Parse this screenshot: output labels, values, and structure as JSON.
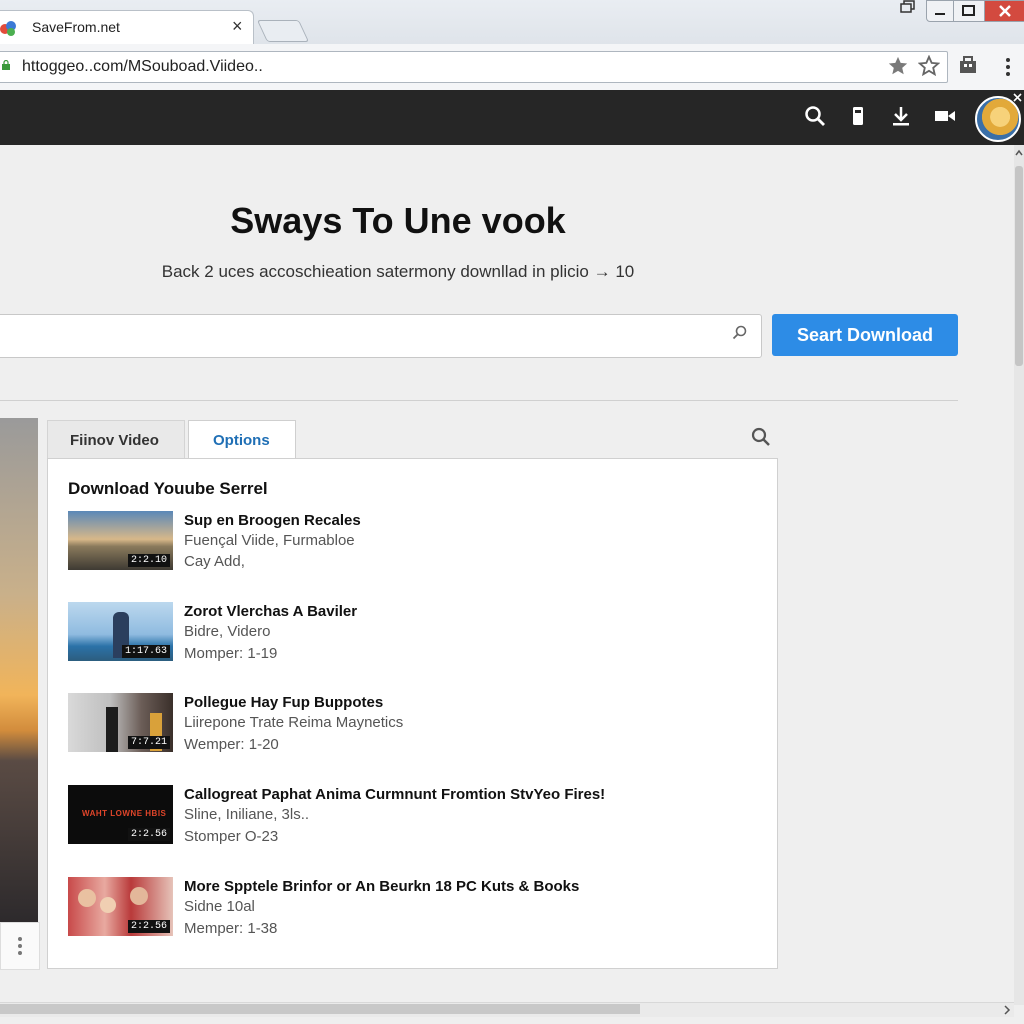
{
  "browser": {
    "tab_title": "SaveFrom.net",
    "tab_close": "×",
    "url": "httoggeo..com/MSouboad.Viideo..",
    "window_controls": [
      "minimize",
      "maximize",
      "close"
    ],
    "icons": [
      "lock-icon",
      "star-icon",
      "bookmark-star-icon",
      "extension-icon",
      "menu-icon"
    ]
  },
  "header": {
    "icons": [
      "search-icon",
      "phone-icon",
      "download-icon",
      "video-icon",
      "avatar"
    ]
  },
  "hero": {
    "heading": "Sways To Une vook",
    "subheading": "Back 2 uces accoschieation satermony downllad in plicio → 10",
    "search_placeholder": "",
    "button_label": "Seart Download"
  },
  "tabs": [
    {
      "label": "Fiinov Video",
      "active": false
    },
    {
      "label": "Options",
      "active": true
    }
  ],
  "panel": {
    "title": "Download Youube Serrel",
    "items": [
      {
        "title": "Sup en Broogen Recales",
        "line1": "Fuençal  Viide, Furmabloe",
        "line2": "Cay Add,",
        "duration": "2:2.10"
      },
      {
        "title": "Zorot Vlerchas A Baviler",
        "line1": "Bidre, Videro",
        "line2": "Momper: 1-19",
        "duration": "1:17.63"
      },
      {
        "title": "Pollegue Hay Fup Buppotes",
        "line1": "Liirepone Trate Reima Maynetics",
        "line2": "Wemper: 1-20",
        "duration": "7:7.21"
      },
      {
        "title": "Callogreat Paphat Anima Curmnunt Fromtion StvYeo Fires!",
        "line1": "Sline, Iniliane, 3ls..",
        "line2": "Stomper O-23",
        "duration": "2:2.56",
        "thumb_text": "WAHT LOWNE HBIS"
      },
      {
        "title": "More Spptele Brinfor or An Beurkn 18 PC Kuts & Books",
        "line1": "Sidne 10al",
        "line2": "Memper: 1-38",
        "duration": "2:2.56"
      }
    ]
  },
  "colors": {
    "header_bg": "#262626",
    "button_bg": "#2d8ce6",
    "tab_active_text": "#1f6fb5"
  }
}
